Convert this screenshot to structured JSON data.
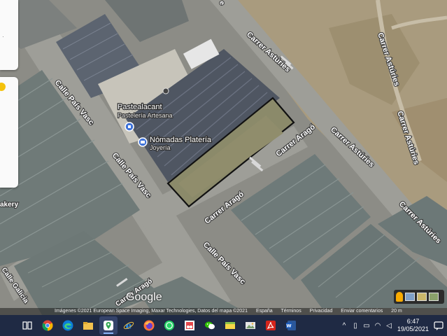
{
  "map": {
    "streets": {
      "calle_pais_vasc_1": "Calle País Vasc",
      "calle_pais_vasc_2": "Calle País Vasc",
      "calle_pais_vasc_3": "Calle País Vasc",
      "carrer_asturies_1": "Carrer Astúries",
      "carrer_asturies_2": "Carrer Astúries",
      "carrer_asturies_3": "Carrer Astúries",
      "carrer_asturies_4": "Carrer Astúries",
      "carrer_asturies_5": "Carrer Astúries",
      "carrer_arago_1": "Carrer Aragó",
      "carrer_arago_2": "Carrer Aragó",
      "carrer_arago_3": "Carrer Aragó",
      "calle_galicia": "Calle Galicia",
      "bakery_partial": "akery"
    },
    "places": [
      {
        "name": "Pastealacant",
        "subtitle": "Pastelería Artesana"
      },
      {
        "name": "Nómadas Platería",
        "subtitle": "Joyería"
      }
    ]
  },
  "attribution": {
    "imagery": "Imágenes ©2021 European Space Imaging, Maxar Technologies, Datos del mapa ©2021",
    "country": "España",
    "terms": "Términos",
    "privacy": "Privacidad",
    "feedback": "Enviar comentarios",
    "scale": "20 m"
  },
  "branding": {
    "logo": "Google"
  },
  "taskbar": {
    "apps": [
      "task-view",
      "chrome",
      "edge",
      "file-explorer",
      "maps",
      "internet-explorer",
      "firefox",
      "whatsapp",
      "snipping-tool",
      "wechat",
      "sticky-notes",
      "photos",
      "acrobat",
      "word"
    ],
    "time": "6:47",
    "date": "19/05/2021"
  },
  "colors": {
    "taskbar": "#1f2a44",
    "panel": "#fafafa",
    "pegman": "#f9ab00"
  }
}
